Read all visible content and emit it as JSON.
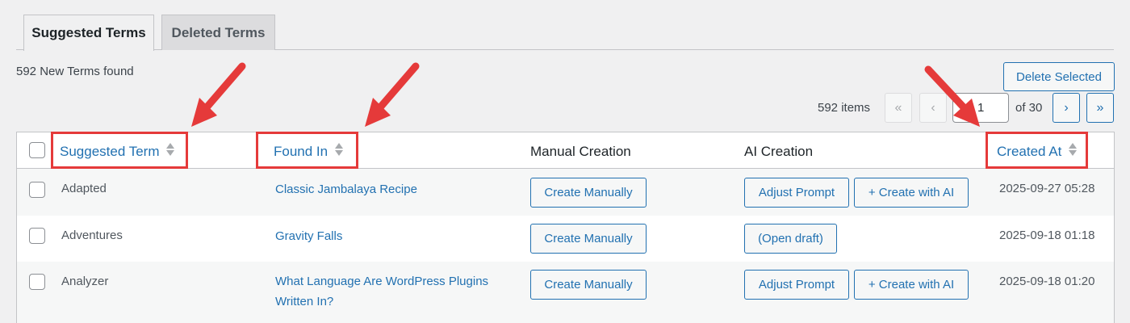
{
  "tabs": [
    {
      "label": "Suggested Terms",
      "active": true
    },
    {
      "label": "Deleted Terms",
      "active": false
    }
  ],
  "found_count": "592 New Terms found",
  "delete_selected_label": "Delete Selected",
  "pagination": {
    "items": "592 items",
    "first": "«",
    "prev": "‹",
    "current_page": "1",
    "of_pages": "of 30",
    "next": "›",
    "last": "»"
  },
  "columns": {
    "term": "Suggested Term",
    "found_in": "Found In",
    "manual": "Manual Creation",
    "ai": "AI Creation",
    "created_at": "Created At"
  },
  "rows": [
    {
      "term": "Adapted",
      "found_in": "Classic Jambalaya Recipe",
      "manual_btn": "Create Manually",
      "ai_btns": [
        "Adjust Prompt",
        "+ Create with AI"
      ],
      "created_at": "2025-09-27 05:28"
    },
    {
      "term": "Adventures",
      "found_in": "Gravity Falls",
      "manual_btn": "Create Manually",
      "ai_btns": [
        "(Open draft)"
      ],
      "created_at": "2025-09-18 01:18"
    },
    {
      "term": "Analyzer",
      "found_in": "What Language Are WordPress Plugins Written In?",
      "manual_btn": "Create Manually",
      "ai_btns": [
        "Adjust Prompt",
        "+ Create with AI"
      ],
      "created_at": "2025-09-18 01:20"
    }
  ],
  "colors": {
    "link_blue": "#2271b1",
    "highlight_red": "#e53a3a",
    "page_bg": "#f0f0f1"
  }
}
